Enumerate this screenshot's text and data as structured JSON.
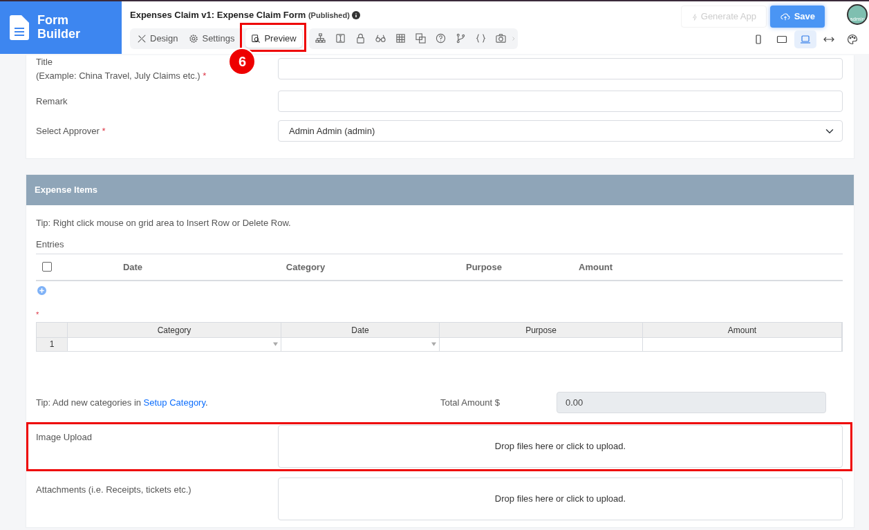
{
  "app": {
    "logo_line1": "Form",
    "logo_line2": "Builder"
  },
  "header": {
    "title": "Expenses Claim v1: Expense Claim Form",
    "status": "(Published)",
    "generate_button": {
      "label": "Generate App",
      "disabled": true
    },
    "save_button": {
      "label": "Save"
    },
    "avatar_text": "admin"
  },
  "tabs": [
    {
      "label": "Design",
      "selected": false
    },
    {
      "label": "Settings",
      "selected": false
    },
    {
      "label": "Preview",
      "selected": true
    }
  ],
  "devices": [
    {
      "selected": false
    },
    {
      "selected": false
    },
    {
      "selected": true
    },
    {
      "selected": false
    },
    {
      "selected": false
    }
  ],
  "form_fields": [
    {
      "label": "Title",
      "hint": "(Example: China Travel, July Claims etc.)",
      "required_mark": "*",
      "kind": "text"
    },
    {
      "label": "Remark",
      "kind": "text"
    },
    {
      "label": "Select Approver",
      "required_mark": "*",
      "kind": "select",
      "value": "Admin Admin (admin)"
    }
  ],
  "expense_section": {
    "title": "Expense Items",
    "tip": "Tip: Right click mouse on grid area to Insert Row or Delete Row.",
    "entries_label": "Entries",
    "entries_columns": [
      "Date",
      "Category",
      "Purpose",
      "Amount"
    ],
    "entries_all_checked": false,
    "grid_required_mark": "*",
    "grid_columns": [
      {
        "label": "Category",
        "kind": "dropdown"
      },
      {
        "label": "Date",
        "kind": "dropdown"
      },
      {
        "label": "Purpose",
        "kind": "text"
      },
      {
        "label": "Amount",
        "kind": "text"
      }
    ],
    "grid_rows": [
      {
        "number": "1"
      }
    ],
    "category_tip": "Tip: Add new categories in ",
    "category_link": "Setup Category",
    "category_tip_end": ".",
    "total_label": "Total Amount $",
    "total_value": "0.00"
  },
  "upload_fields": [
    {
      "label": "Image Upload",
      "prompt": "Drop files here or click to upload.",
      "highlighted": true
    },
    {
      "label": "Attachments (i.e. Receipts, tickets etc.)",
      "prompt": "Drop files here or click to upload.",
      "highlighted": false
    }
  ],
  "annotation": {
    "step": "6"
  }
}
